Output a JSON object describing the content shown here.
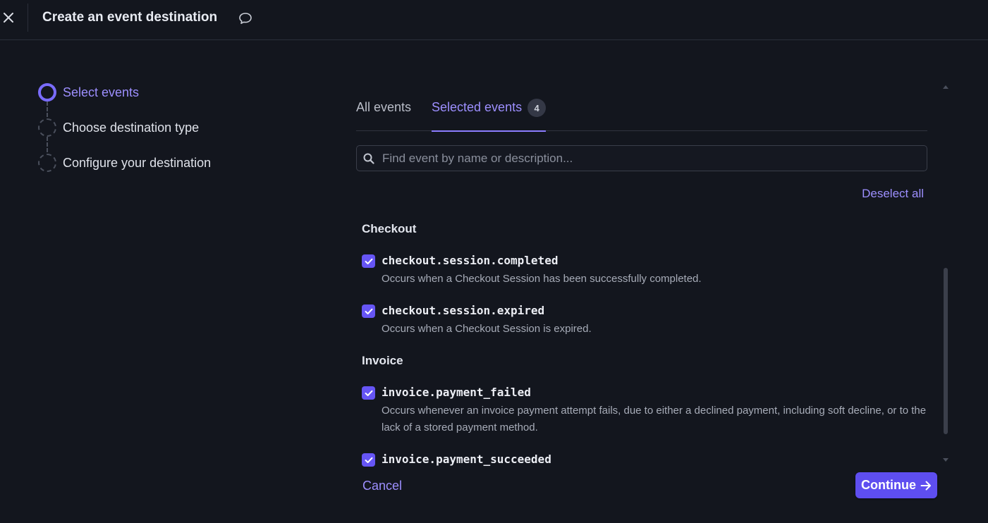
{
  "header": {
    "title": "Create an event destination",
    "close_icon": "close-icon",
    "feedback_icon": "speech-bubble-icon"
  },
  "stepper": {
    "steps": [
      {
        "label": "Select events",
        "state": "active"
      },
      {
        "label": "Choose destination type",
        "state": "pending"
      },
      {
        "label": "Configure your destination",
        "state": "pending"
      }
    ]
  },
  "tabs": [
    {
      "label": "All events",
      "active": false
    },
    {
      "label": "Selected events",
      "active": true,
      "badge": "4"
    }
  ],
  "search": {
    "placeholder": "Find event by name or description...",
    "value": ""
  },
  "actions": {
    "deselect_all": "Deselect all",
    "cancel": "Cancel",
    "continue": "Continue"
  },
  "groups": [
    {
      "title": "Checkout",
      "events": [
        {
          "name": "checkout.session.completed",
          "description": "Occurs when a Checkout Session has been successfully completed.",
          "checked": true
        },
        {
          "name": "checkout.session.expired",
          "description": "Occurs when a Checkout Session is expired.",
          "checked": true
        }
      ]
    },
    {
      "title": "Invoice",
      "events": [
        {
          "name": "invoice.payment_failed",
          "description": "Occurs whenever an invoice payment attempt fails, due to either a declined payment, including soft decline, or to the lack of a stored payment method.",
          "checked": true
        },
        {
          "name": "invoice.payment_succeeded",
          "description": "",
          "checked": true
        }
      ]
    }
  ],
  "colors": {
    "background": "#13161e",
    "accent": "#7a6cff",
    "primary_button": "#5e4ef0",
    "checkbox": "#6655f5"
  }
}
